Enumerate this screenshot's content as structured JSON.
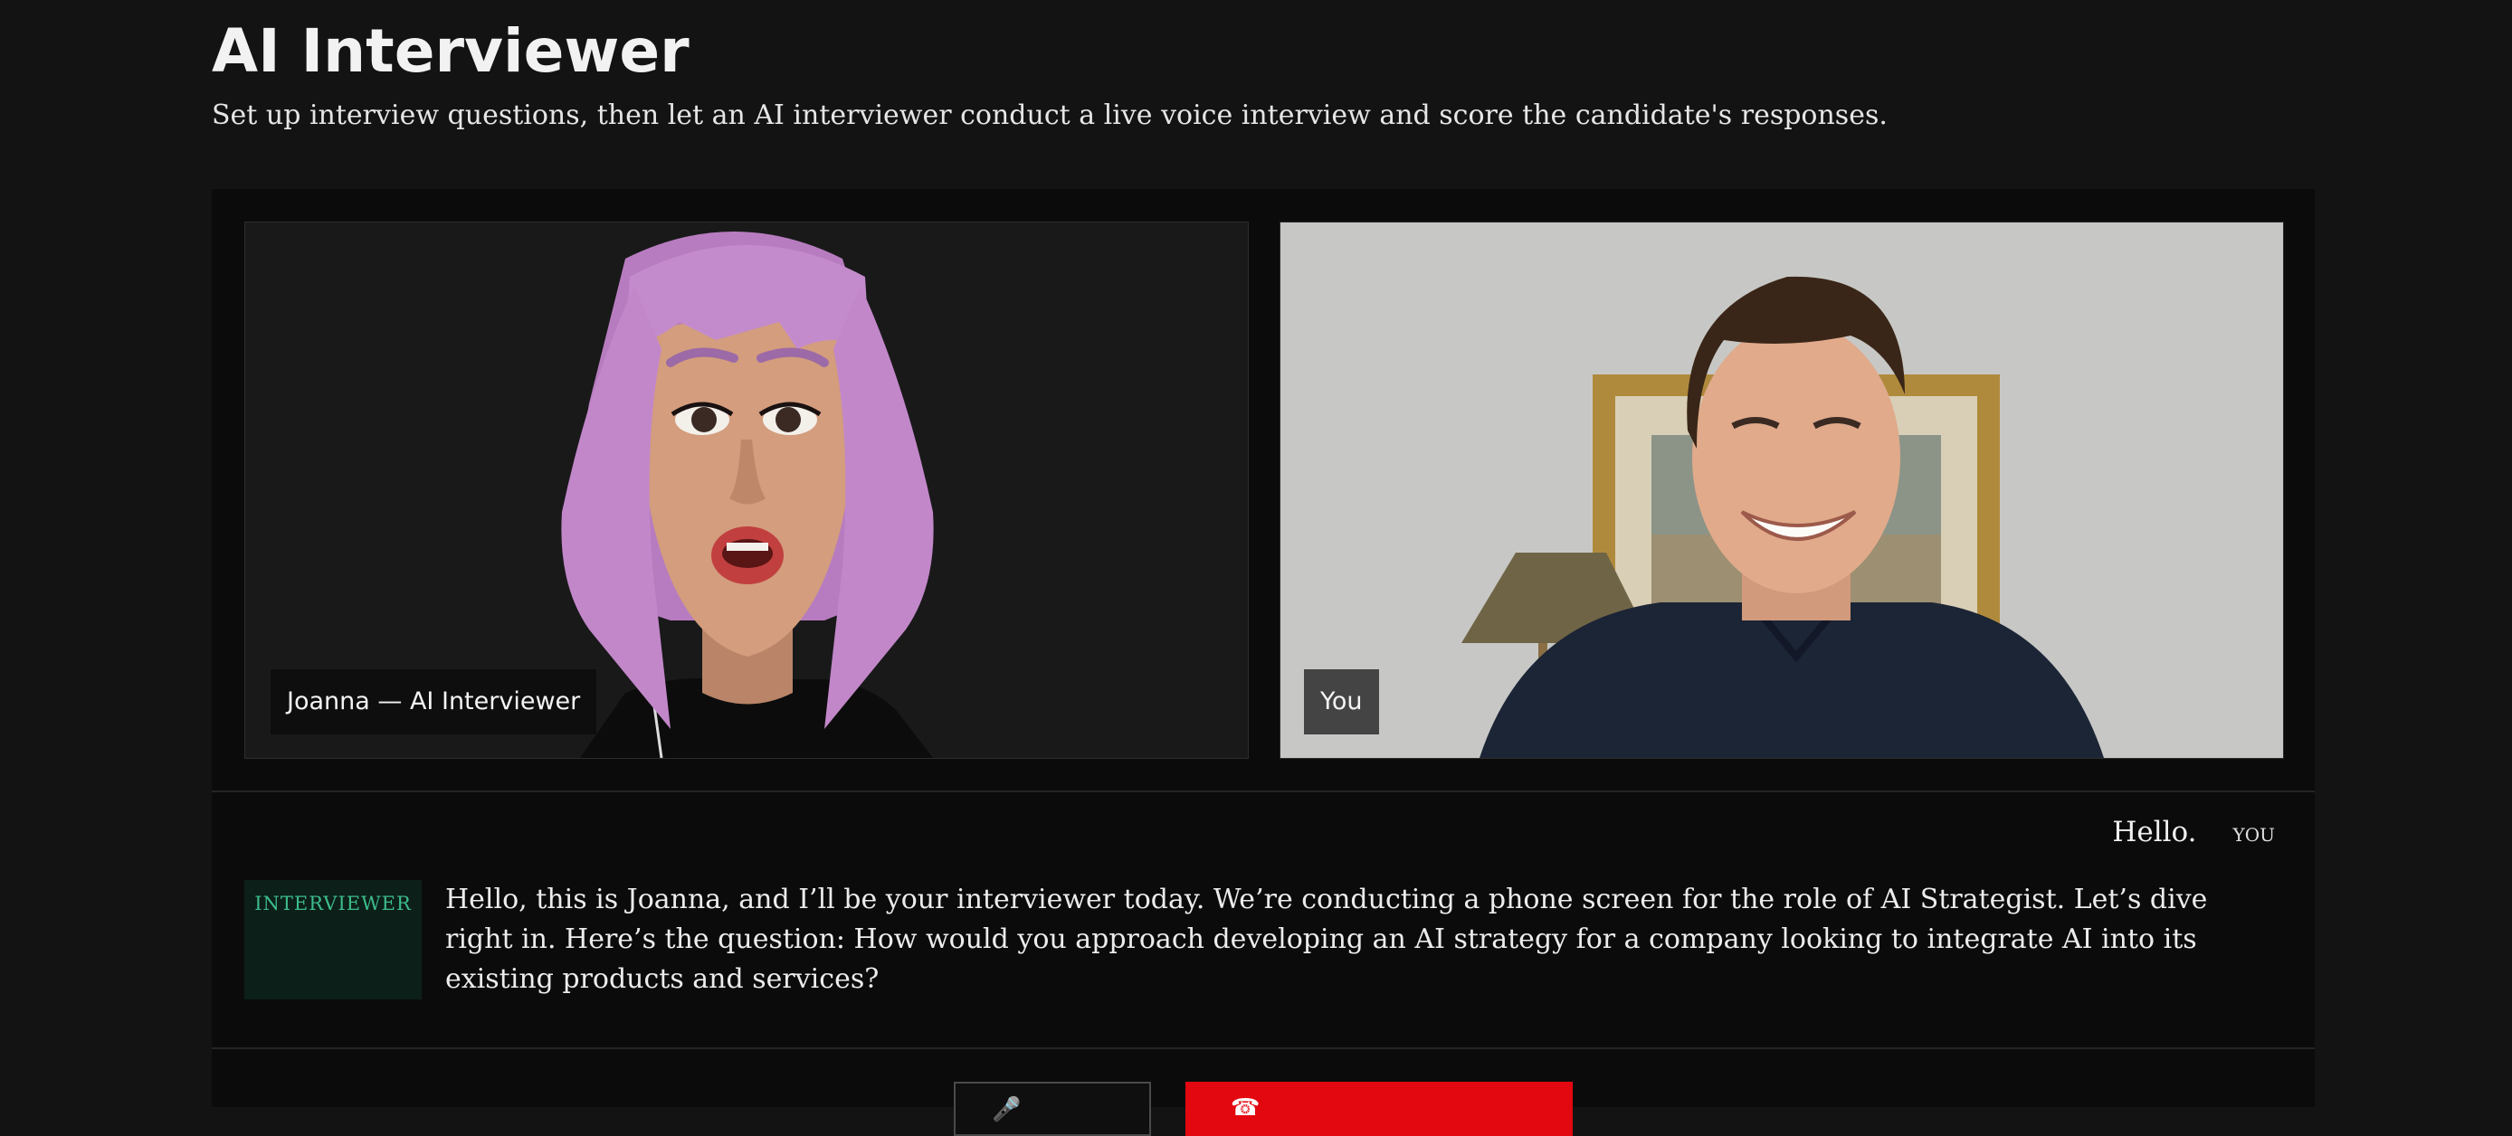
{
  "page": {
    "title": "AI Interviewer",
    "subtitle": "Set up interview questions, then let an AI interviewer conduct a live voice interview and score the candidate's responses."
  },
  "video": {
    "ai_label": "Joanna — AI Interviewer",
    "user_label": "You"
  },
  "transcript": {
    "user_message": "Hello.",
    "user_tag": "YOU",
    "interviewer_tag": "INTERVIEWER",
    "interviewer_message": "Hello, this is Joanna, and I’ll be your interviewer today. We’re conducting a phone screen for the role of AI Strategist. Let’s dive right in. Here’s the question: How would you approach developing an AI strategy for a company looking to integrate AI into its existing products and services?"
  },
  "colors": {
    "accent_green": "#3dbc8c",
    "end_button_red": "#e3070f",
    "ai_hair": "#c287c9",
    "background": "#131313"
  },
  "icons": {
    "secondary_button_icon": "microphone-icon",
    "end_button_icon": "phone-end-icon"
  }
}
